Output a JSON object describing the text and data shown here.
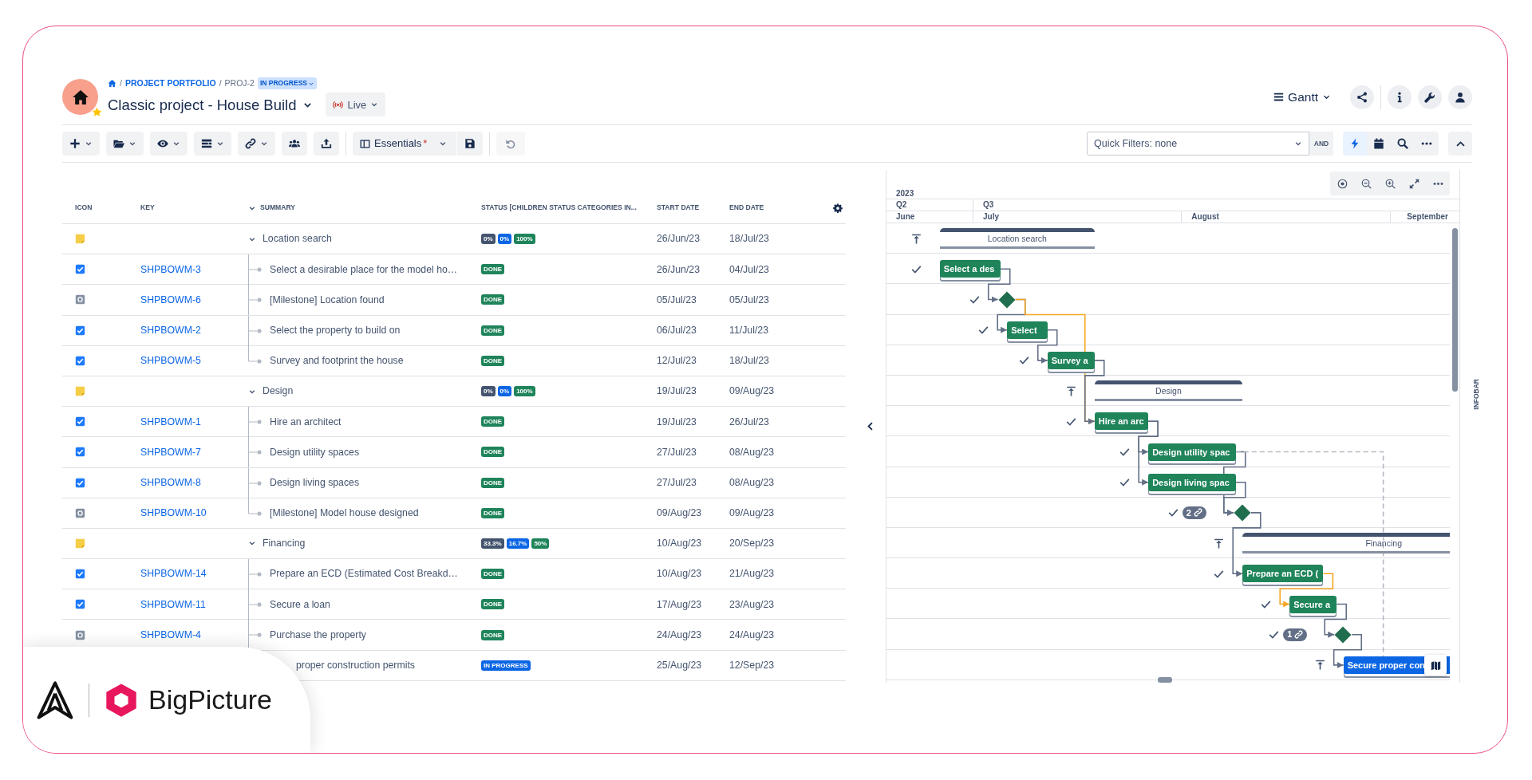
{
  "header": {
    "breadcrumb": [
      "PROJECT PORTFOLIO",
      "PROJ-2"
    ],
    "separator": "/",
    "project_status": "IN PROGRESS",
    "title": "Classic project - House Build",
    "favorite": true,
    "mode": "Live",
    "view": "Gantt"
  },
  "toolbar": {
    "view_preset": "Essentials",
    "unsaved_mark": "*",
    "undo_disabled": true,
    "quick_filters": "Quick Filters: none",
    "filter_logic": "AND",
    "auto_schedule_selected": true
  },
  "table": {
    "columns": [
      "ICON",
      "KEY",
      "SUMMARY",
      "STATUS [CHILDREN STATUS CATEGORIES IN...",
      "START DATE",
      "END DATE"
    ],
    "rows": [
      {
        "kind": "group",
        "summary": "Location search",
        "expanded": true,
        "progress": [
          {
            "color": "#44546f",
            "label": "0%"
          },
          {
            "color": "#0c66e4",
            "label": "0%"
          },
          {
            "color": "#1f845a",
            "label": "100%"
          }
        ],
        "start": "26/Jun/23",
        "end": "18/Jul/23",
        "children": [
          {
            "kind": "task",
            "key": "SHPBOWM-3",
            "summary": "Select a desirable place for the model ho…",
            "status": "DONE",
            "color": "#1f845a",
            "start": "26/Jun/23",
            "end": "04/Jul/23"
          },
          {
            "kind": "milestone",
            "key": "SHPBOWM-6",
            "summary": "[Milestone] Location found",
            "status": "DONE",
            "color": "#1f845a",
            "start": "05/Jul/23",
            "end": "05/Jul/23"
          },
          {
            "kind": "task",
            "key": "SHPBOWM-2",
            "summary": "Select the property to build on",
            "status": "DONE",
            "color": "#1f845a",
            "start": "06/Jul/23",
            "end": "11/Jul/23"
          },
          {
            "kind": "task",
            "key": "SHPBOWM-5",
            "summary": "Survey and footprint the house",
            "status": "DONE",
            "color": "#1f845a",
            "start": "12/Jul/23",
            "end": "18/Jul/23"
          }
        ]
      },
      {
        "kind": "group",
        "summary": "Design",
        "expanded": true,
        "progress": [
          {
            "color": "#44546f",
            "label": "0%"
          },
          {
            "color": "#0c66e4",
            "label": "0%"
          },
          {
            "color": "#1f845a",
            "label": "100%"
          }
        ],
        "start": "19/Jul/23",
        "end": "09/Aug/23",
        "children": [
          {
            "kind": "task",
            "key": "SHPBOWM-1",
            "summary": "Hire an architect",
            "status": "DONE",
            "color": "#1f845a",
            "start": "19/Jul/23",
            "end": "26/Jul/23"
          },
          {
            "kind": "task",
            "key": "SHPBOWM-7",
            "summary": "Design utility spaces",
            "status": "DONE",
            "color": "#1f845a",
            "start": "27/Jul/23",
            "end": "08/Aug/23"
          },
          {
            "kind": "task",
            "key": "SHPBOWM-8",
            "summary": "Design living spaces",
            "status": "DONE",
            "color": "#1f845a",
            "start": "27/Jul/23",
            "end": "08/Aug/23"
          },
          {
            "kind": "milestone",
            "key": "SHPBOWM-10",
            "summary": "[Milestone] Model house designed",
            "status": "DONE",
            "color": "#1f845a",
            "start": "09/Aug/23",
            "end": "09/Aug/23"
          }
        ]
      },
      {
        "kind": "group",
        "summary": "Financing",
        "expanded": true,
        "progress": [
          {
            "color": "#44546f",
            "label": "33.3%"
          },
          {
            "color": "#0c66e4",
            "label": "16.7%"
          },
          {
            "color": "#1f845a",
            "label": "50%"
          }
        ],
        "start": "10/Aug/23",
        "end": "20/Sep/23",
        "children": [
          {
            "kind": "task",
            "key": "SHPBOWM-14",
            "summary": "Prepare an ECD (Estimated Cost Breakd…",
            "status": "DONE",
            "color": "#1f845a",
            "start": "10/Aug/23",
            "end": "21/Aug/23"
          },
          {
            "kind": "task",
            "key": "SHPBOWM-11",
            "summary": "Secure a loan",
            "status": "DONE",
            "color": "#1f845a",
            "start": "17/Aug/23",
            "end": "23/Aug/23"
          },
          {
            "kind": "milestone",
            "key": "SHPBOWM-4",
            "summary": "Purchase the property",
            "status": "DONE",
            "color": "#1f845a",
            "start": "24/Aug/23",
            "end": "24/Aug/23"
          },
          {
            "summary": "proper construction permits",
            "status": "IN PROGRESS",
            "color": "#0c66e4",
            "start": "25/Aug/23",
            "end": "12/Sep/23"
          }
        ]
      }
    ]
  },
  "gantt": {
    "timescale": {
      "year": "2023",
      "quarters": [
        "Q2",
        "Q3"
      ],
      "months": [
        "June",
        "July",
        "August",
        "September"
      ]
    },
    "items": [
      {
        "kind": "summary",
        "label": "Location search",
        "done": false
      },
      {
        "kind": "task",
        "label": "Select a des",
        "done": true
      },
      {
        "kind": "milestone",
        "done": true
      },
      {
        "kind": "task",
        "label": "Select",
        "done": true
      },
      {
        "kind": "task",
        "label": "Survey a",
        "done": true
      },
      {
        "kind": "summary",
        "label": "Design",
        "done": false
      },
      {
        "kind": "task",
        "label": "Hire an arc",
        "done": true
      },
      {
        "kind": "task",
        "label": "Design utility spac",
        "done": true
      },
      {
        "kind": "task",
        "label": "Design living spac",
        "done": true
      },
      {
        "kind": "milestone",
        "done": true,
        "link_count": "2"
      },
      {
        "kind": "summary",
        "label": "Financing",
        "done": false
      },
      {
        "kind": "task",
        "label": "Prepare an ECD (",
        "done": true
      },
      {
        "kind": "task",
        "label": "Secure a",
        "done": true
      },
      {
        "kind": "milestone",
        "done": true,
        "link_count": "1"
      },
      {
        "kind": "task",
        "label": "Secure proper con",
        "done": false
      }
    ],
    "infobar": "INFOBAR"
  },
  "brand_overlay": {
    "name": "BigPicture"
  }
}
